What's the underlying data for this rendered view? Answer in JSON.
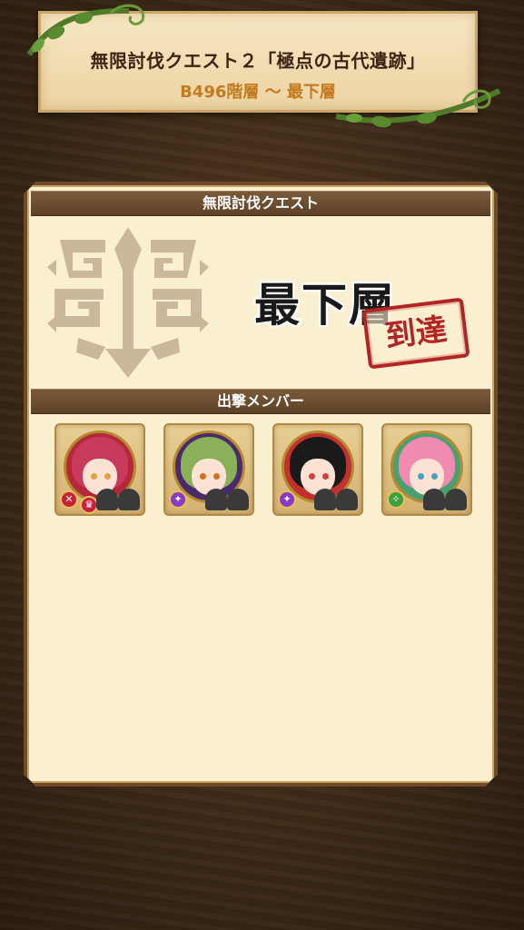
{
  "header": {
    "title": "無限討伐クエスト２「極点の古代遺跡」",
    "subtitle": "B496階層 〜 最下層"
  },
  "quest_section": {
    "header_label": "無限討伐クエスト",
    "floor_label": "最下層",
    "stamp_label": "到達"
  },
  "members_section": {
    "header_label": "出撃メンバー",
    "members": [
      {
        "hair_color": "#c83a5c",
        "frame_color": "#b5283a",
        "eye_color": "#e0a040",
        "badge1": "#c8203a",
        "badge2": "#c8203a"
      },
      {
        "hair_color": "#8ab05a",
        "frame_color": "#4a2a6a",
        "eye_color": "#d07020",
        "badge1": "#8a3ac0"
      },
      {
        "hair_color": "#1a1a1a",
        "frame_color": "#c23030",
        "eye_color": "#d04040",
        "badge1": "#8a3ac0"
      },
      {
        "hair_color": "#f08ab0",
        "frame_color": "#4aa070",
        "eye_color": "#4aa0c0",
        "badge1": "#3aa040"
      }
    ]
  },
  "colors": {
    "panel_bg": "#faefcf",
    "header_bar": "#6e4c2a",
    "subtitle": "#c47a1e",
    "stamp": "#b32424"
  }
}
